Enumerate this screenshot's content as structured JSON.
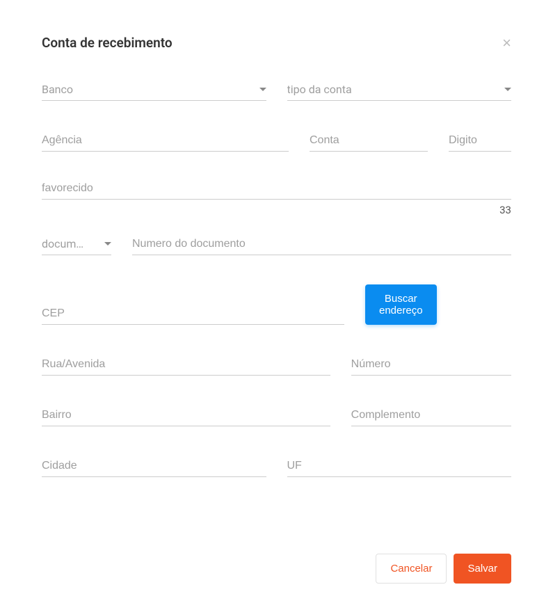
{
  "header": {
    "title": "Conta de recebimento"
  },
  "fields": {
    "banco": {
      "placeholder": "Banco"
    },
    "tipo_conta": {
      "placeholder": "tipo da conta"
    },
    "agencia": {
      "placeholder": "Agência"
    },
    "conta": {
      "placeholder": "Conta"
    },
    "digito": {
      "placeholder": "Digito"
    },
    "favorecido": {
      "placeholder": "favorecido",
      "counter": "33"
    },
    "doc_type": {
      "placeholder": "docum…"
    },
    "doc_num": {
      "placeholder": "Numero do documento"
    },
    "cep": {
      "placeholder": "CEP"
    },
    "rua": {
      "placeholder": "Rua/Avenida"
    },
    "numero": {
      "placeholder": "Número"
    },
    "bairro": {
      "placeholder": "Bairro"
    },
    "complemento": {
      "placeholder": "Complemento"
    },
    "cidade": {
      "placeholder": "Cidade"
    },
    "uf": {
      "placeholder": "UF"
    }
  },
  "buttons": {
    "buscar": "Buscar endereço",
    "cancelar": "Cancelar",
    "salvar": "Salvar"
  }
}
